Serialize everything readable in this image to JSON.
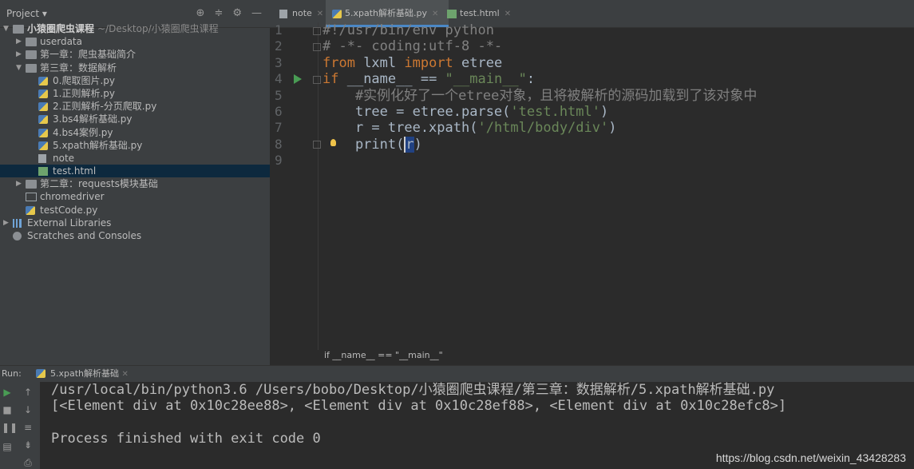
{
  "project_panel": {
    "title": "Project ▾",
    "tree": [
      {
        "label": "小猿圈爬虫课程",
        "path": "~/Desktop/小猿圈爬虫课程",
        "level": 0,
        "arrow": "▼",
        "icon": "folder-icon"
      },
      {
        "label": "userdata",
        "level": 1,
        "arrow": "▶",
        "icon": "folder-icon"
      },
      {
        "label": "第一章：爬虫基础简介",
        "level": 1,
        "arrow": "▶",
        "icon": "folder-icon"
      },
      {
        "label": "第三章：数据解析",
        "level": 1,
        "arrow": "▼",
        "icon": "folder-icon"
      },
      {
        "label": "0.爬取图片.py",
        "level": 2,
        "icon": "python-file-icon"
      },
      {
        "label": "1.正则解析.py",
        "level": 2,
        "icon": "python-file-icon"
      },
      {
        "label": "2.正则解析-分页爬取.py",
        "level": 2,
        "icon": "python-file-icon"
      },
      {
        "label": "3.bs4解析基础.py",
        "level": 2,
        "icon": "python-file-icon"
      },
      {
        "label": "4.bs4案例.py",
        "level": 2,
        "icon": "python-file-icon"
      },
      {
        "label": "5.xpath解析基础.py",
        "level": 2,
        "icon": "python-file-icon"
      },
      {
        "label": "note",
        "level": 2,
        "icon": "text-file-icon"
      },
      {
        "label": "test.html",
        "level": 2,
        "icon": "html-file-icon",
        "selected": true
      },
      {
        "label": "第二章：requests模块基础",
        "level": 1,
        "arrow": "▶",
        "icon": "folder-icon"
      },
      {
        "label": "chromedriver",
        "level": 1,
        "icon": "executable-file-icon"
      },
      {
        "label": "testCode.py",
        "level": 1,
        "icon": "python-file-icon"
      },
      {
        "label": "External Libraries",
        "level": 0,
        "arrow": "▶",
        "icon": "library-icon"
      },
      {
        "label": "Scratches and Consoles",
        "level": 0,
        "icon": "scratch-icon"
      }
    ]
  },
  "editor": {
    "tabs": [
      {
        "label": "note",
        "icon": "text-file-icon",
        "active": false
      },
      {
        "label": "5.xpath解析基础.py",
        "icon": "python-file-icon",
        "active": true
      },
      {
        "label": "test.html",
        "icon": "html-file-icon",
        "active": false
      }
    ],
    "line_numbers": [
      "1",
      "2",
      "3",
      "4",
      "5",
      "6",
      "7",
      "8",
      "9"
    ],
    "breadcrumb": "if __name__ == \"__main__\"",
    "code": {
      "l1": "#!/usr/bin/env python",
      "l2": "# -*- coding:utf-8 -*-",
      "l3_kw1": "from",
      "l3_mod": " lxml ",
      "l3_kw2": "import",
      "l3_name": " etree",
      "l4_kw": "if",
      "l4_mid": " __name__ == ",
      "l4_str": "\"__main__\"",
      "l4_end": ":",
      "l5": "    #实例化好了一个etree对象，且将被解析的源码加载到了该对象中",
      "l6_a": "    tree = etree.parse(",
      "l6_str": "'test.html'",
      "l6_b": ")",
      "l7_a": "    r = tree.xpath(",
      "l7_str": "'/html/body/div'",
      "l7_b": ")",
      "l8_a": "    print(",
      "l8_sel": "r",
      "l8_b": ")"
    }
  },
  "run_panel": {
    "label": "Run:",
    "tab": "5.xpath解析基础",
    "output": [
      "/usr/local/bin/python3.6 /Users/bobo/Desktop/小猿圈爬虫课程/第三章：数据解析/5.xpath解析基础.py",
      "[<Element div at 0x10c28ee88>, <Element div at 0x10c28ef88>, <Element div at 0x10c28efc8>]",
      "",
      "Process finished with exit code 0"
    ]
  },
  "watermark": "https://blog.csdn.net/weixin_43428283",
  "colors": {
    "keyword": "#cc7832",
    "string": "#6a8759",
    "comment": "#808080",
    "selection": "#0d293e"
  }
}
